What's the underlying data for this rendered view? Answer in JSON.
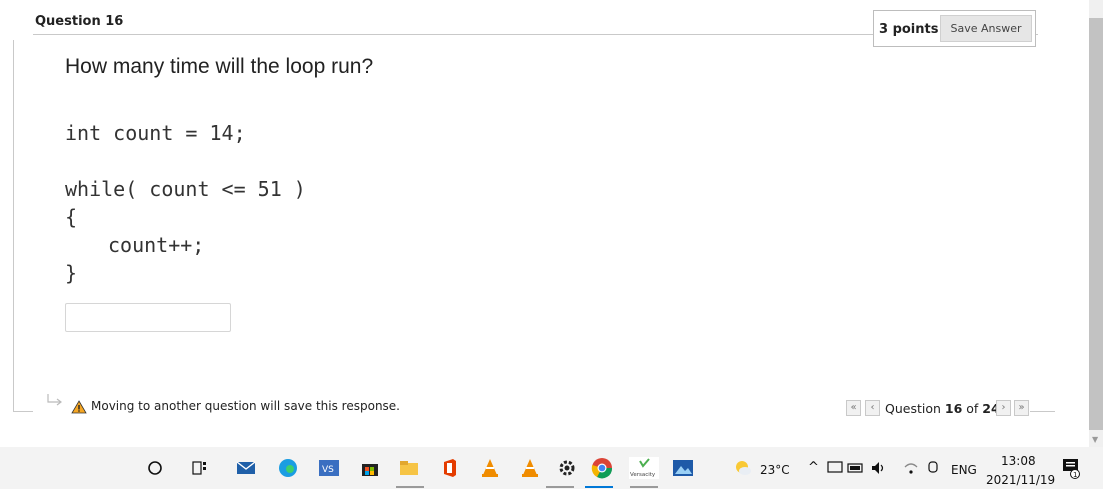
{
  "question": {
    "title": "Question 16",
    "points": "3 points",
    "save_label": "Save Answer",
    "prompt": "How many time will the loop run?"
  },
  "code": {
    "line1": "int count = 14;",
    "line2": "while( count <= 51 )",
    "line3": "{",
    "line4": "count++;",
    "line5": "}"
  },
  "answer": {
    "value": ""
  },
  "footer": {
    "warning": "Moving to another question will save this response.",
    "nav_prefix": "Question ",
    "nav_current": "16",
    "nav_of": " of ",
    "nav_total": "24"
  },
  "taskbar": {
    "weather": "23°C",
    "lang": "ENG",
    "time": "13:08",
    "date": "2021/11/19",
    "notification_count": "1",
    "versacity_label": "Versacity",
    "icons": [
      "search-circle-icon",
      "task-view-icon",
      "mail-icon",
      "edge-icon",
      "visual-studio-icon",
      "store-icon",
      "file-explorer-icon",
      "office-icon",
      "vlc-icon",
      "vlc-icon",
      "settings-icon",
      "chrome-icon",
      "versacity-icon",
      "photos-icon"
    ]
  },
  "colors": {
    "accent": "#0078d7",
    "warning": "#f5a623",
    "vlc": "#f08c00",
    "office": "#e43c00"
  }
}
